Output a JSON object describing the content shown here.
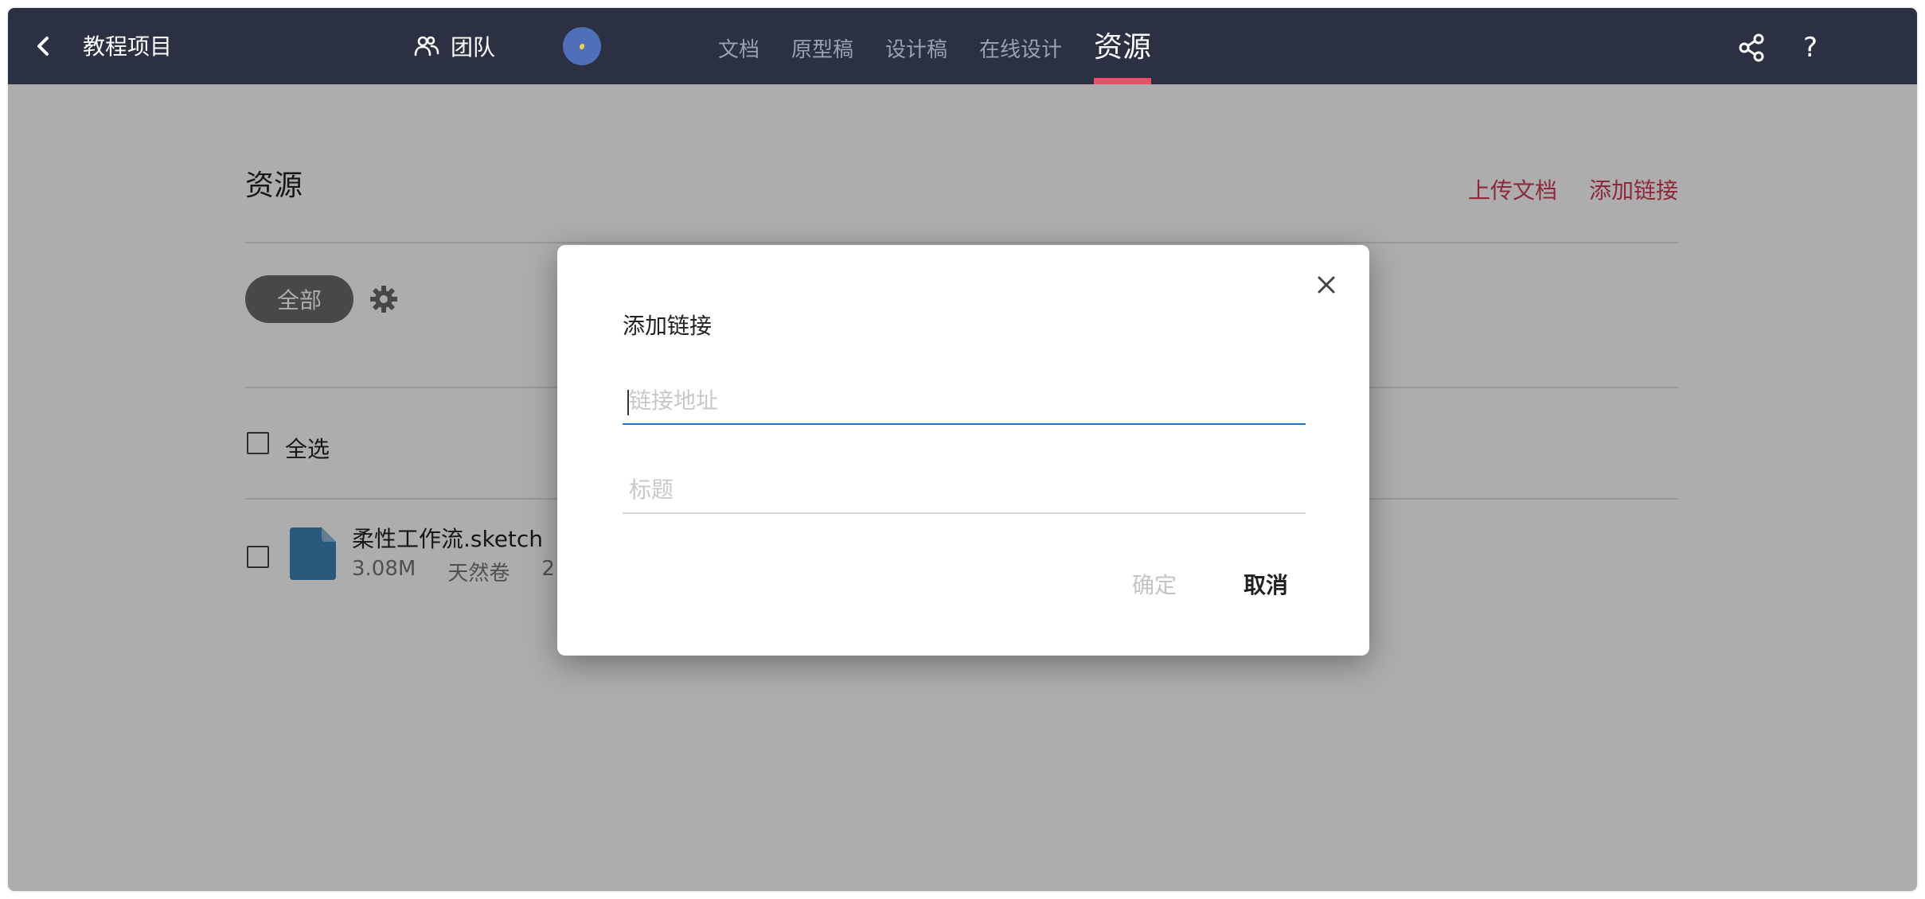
{
  "topbar": {
    "back_icon": "chevron-left-icon",
    "project_title": "教程项目",
    "team_icon": "users-icon",
    "team_label": "团队",
    "tabs": [
      {
        "label": "文档",
        "active": false
      },
      {
        "label": "原型稿",
        "active": false
      },
      {
        "label": "设计稿",
        "active": false
      },
      {
        "label": "在线设计",
        "active": false
      },
      {
        "label": "资源",
        "active": true
      }
    ],
    "share_icon": "share-icon",
    "help_label": "?",
    "accent_color": "#e8506a",
    "background_color": "#2b3142"
  },
  "main": {
    "section_title": "资源",
    "actions": {
      "upload_label": "上传文档",
      "add_link_label": "添加链接"
    },
    "filter": {
      "chip_label": "全部",
      "settings_icon": "gear-icon"
    },
    "select_all_label": "全选",
    "files": [
      {
        "name": "柔性工作流.sketch",
        "size": "3.08M",
        "author": "天然卷",
        "date_partial": "2",
        "icon": "file-icon",
        "icon_color": "#3a85b7"
      }
    ]
  },
  "modal": {
    "title": "添加链接",
    "url_placeholder": "链接地址",
    "url_value": "",
    "caption_placeholder": "标题",
    "caption_value": "",
    "ok_label": "确定",
    "cancel_label": "取消",
    "close_icon": "close-icon"
  }
}
